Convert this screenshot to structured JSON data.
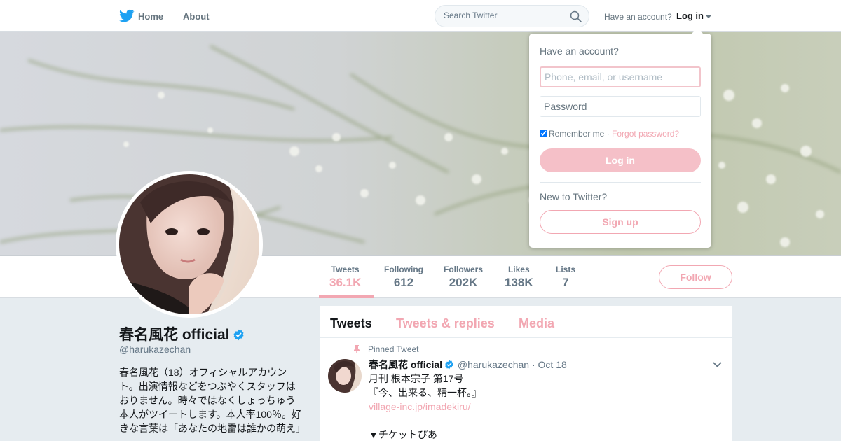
{
  "topbar": {
    "home_label": "Home",
    "about_label": "About",
    "search_placeholder": "Search Twitter",
    "have_account": "Have an account?",
    "login_label": "Log in"
  },
  "profile": {
    "name": "春名風花 official",
    "handle": "@harukazechan",
    "bio": "春名風花（18）オフィシャルアカウント。出演情報などをつぶやくスタッフはおりません。時々ではなくしょっちゅう本人がツイートします。本人率100％。好きな言葉は「あなたの地雷は誰かの萌え」"
  },
  "stats": [
    {
      "label": "Tweets",
      "value": "36.1K"
    },
    {
      "label": "Following",
      "value": "612"
    },
    {
      "label": "Followers",
      "value": "202K"
    },
    {
      "label": "Likes",
      "value": "138K"
    },
    {
      "label": "Lists",
      "value": "7"
    }
  ],
  "follow_label": "Follow",
  "timeline": {
    "tabs": [
      "Tweets",
      "Tweets & replies",
      "Media"
    ],
    "pinned_label": "Pinned Tweet",
    "tweet": {
      "name": "春名風花 official",
      "handle": "@harukazechan",
      "separator": "·",
      "date": "Oct 18",
      "lines": [
        "月刊 根本宗子 第17号",
        "『今、出来る、精一杯。』"
      ],
      "link": "village-inc.jp/imadekiru/",
      "line_after": "▼チケットぴあ"
    }
  },
  "login_dropdown": {
    "title": "Have an account?",
    "username_placeholder": "Phone, email, or username",
    "password_placeholder": "Password",
    "remember_label": "Remember me",
    "dot": "·",
    "forgot_label": "Forgot password?",
    "login_button": "Log in",
    "new_label": "New to Twitter?",
    "signup_button": "Sign up"
  },
  "colors": {
    "accent": "#f2a7b2",
    "twitter_blue": "#1da1f2",
    "text": "#14171a",
    "muted": "#657786"
  }
}
